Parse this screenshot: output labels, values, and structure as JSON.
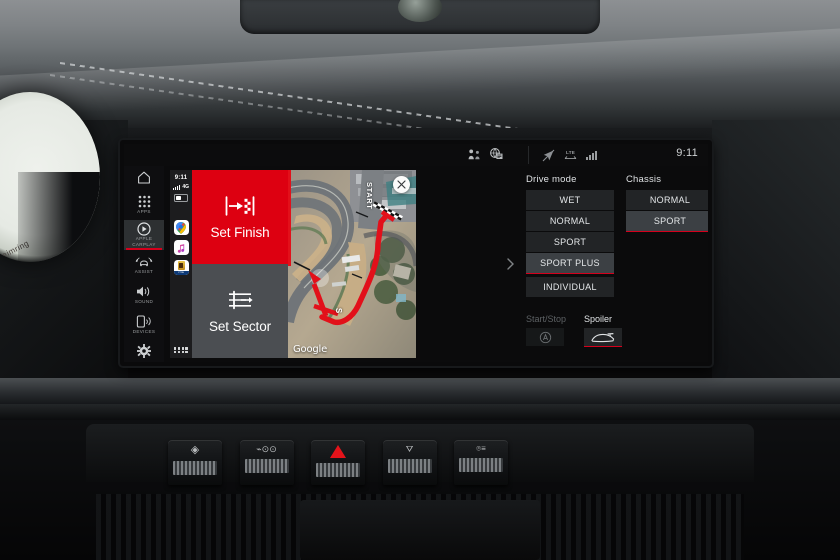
{
  "vehicle_cluster": {
    "track_name": "Hockenheimring"
  },
  "screen": {
    "status_bar": {
      "icons_left": [
        "passenger-seat-icon",
        "apps-grid-icon"
      ],
      "icons_right": [
        "location-off-icon",
        "lte-icon",
        "signal-bars-icon"
      ],
      "clock": "9:11"
    },
    "nav_rail": {
      "home_icon": "home-icon",
      "items": [
        {
          "label": "APPS",
          "icon": "grid-icon",
          "active": false
        },
        {
          "label": "APPLE\nCARPLAY",
          "icon": "carplay-icon",
          "active": true
        },
        {
          "label": "ASSIST",
          "icon": "assist-car-icon",
          "active": false
        },
        {
          "label": "SOUND",
          "icon": "speaker-icon",
          "active": false
        },
        {
          "label": "DEVICES",
          "icon": "phone-wifi-icon",
          "active": false
        }
      ],
      "settings_icon": "gear-icon"
    },
    "carplay": {
      "status": {
        "time": "9:11",
        "network": "4G",
        "signal_bars": 4,
        "battery_percent": 45
      },
      "dock_apps": [
        "google-maps-icon",
        "apple-music-icon",
        "porsche-track-precision-icon"
      ],
      "home_grid_icon": "app-grid-icon",
      "tiles": [
        {
          "label": "Set Finish",
          "icon": "set-finish-icon",
          "accent": "#dd0011",
          "selected": true
        },
        {
          "label": "Set Sector",
          "icon": "set-sector-icon",
          "accent": "#4b4e52",
          "selected": false
        }
      ],
      "map": {
        "attribution": "Google",
        "start_label": "START",
        "sector_label": "S",
        "close_icon": "close-icon",
        "route_color": "#e2101a"
      }
    },
    "expand_chevron_icon": "chevron-right-icon",
    "vehicle_panel": {
      "drive_mode": {
        "title": "Drive mode",
        "options": [
          "WET",
          "NORMAL",
          "SPORT",
          "SPORT PLUS",
          "INDIVIDUAL"
        ],
        "selected": "SPORT PLUS"
      },
      "chassis": {
        "title": "Chassis",
        "options": [
          "NORMAL",
          "SPORT"
        ],
        "selected": "SPORT"
      },
      "start_stop": {
        "label": "Start/Stop",
        "icon": "auto-start-stop-icon",
        "enabled": false,
        "active": false
      },
      "spoiler": {
        "label": "Spoiler",
        "icon": "rear-spoiler-icon",
        "enabled": true,
        "active": true
      }
    }
  },
  "console_buttons": [
    {
      "icon": "pdcc-icon",
      "name": "suspension-button"
    },
    {
      "icon": "sport-exhaust-icon",
      "name": "sport-exhaust-button"
    },
    {
      "icon": "hazard-triangle-icon",
      "name": "hazard-lights-button",
      "color": "#e4131a"
    },
    {
      "icon": "esc-off-icon",
      "name": "esc-button"
    },
    {
      "icon": "pasm-icon",
      "name": "pasm-button"
    }
  ],
  "colors": {
    "accent_red": "#d5001c",
    "tile_red": "#dd0011",
    "panel_bg": "#0b0b0c"
  }
}
